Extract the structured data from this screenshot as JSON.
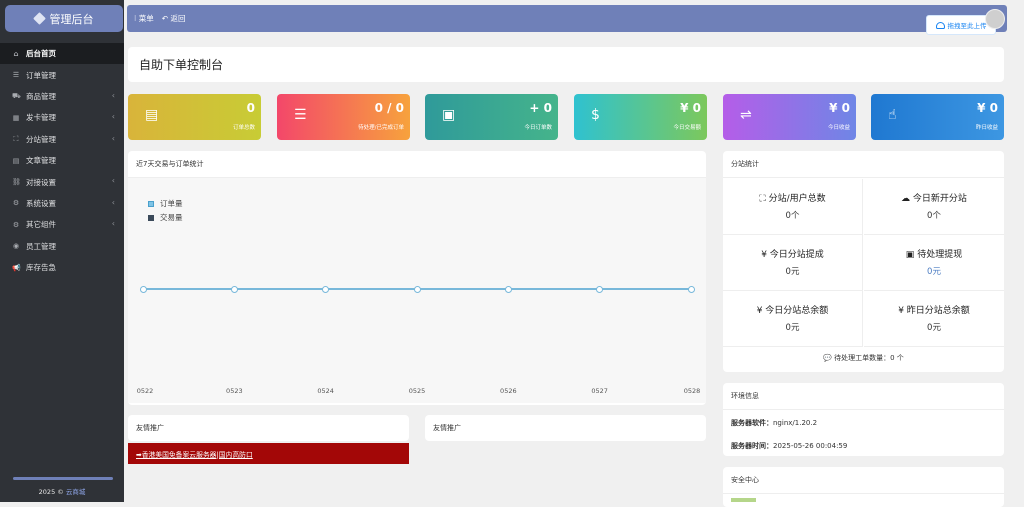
{
  "sidebar": {
    "brand": "管理后台",
    "items": [
      {
        "label": "后台首页",
        "icon": "home-icon",
        "glyph": "⌂",
        "active": true,
        "arrow": false
      },
      {
        "label": "订单管理",
        "icon": "list-icon",
        "glyph": "☰",
        "active": false,
        "arrow": false
      },
      {
        "label": "商品管理",
        "icon": "cart-icon",
        "glyph": "⛟",
        "active": false,
        "arrow": true
      },
      {
        "label": "发卡管理",
        "icon": "grid-icon",
        "glyph": "▦",
        "active": false,
        "arrow": true
      },
      {
        "label": "分站管理",
        "icon": "sitemap-icon",
        "glyph": "⛶",
        "active": false,
        "arrow": true
      },
      {
        "label": "文章管理",
        "icon": "book-icon",
        "glyph": "▤",
        "active": false,
        "arrow": false
      },
      {
        "label": "对接设置",
        "icon": "link-icon",
        "glyph": "⛓",
        "active": false,
        "arrow": true
      },
      {
        "label": "系统设置",
        "icon": "gear-icon",
        "glyph": "⚙",
        "active": false,
        "arrow": true
      },
      {
        "label": "其它组件",
        "icon": "gears-icon",
        "glyph": "⚙",
        "active": false,
        "arrow": true
      },
      {
        "label": "员工管理",
        "icon": "user-icon",
        "glyph": "◉",
        "active": false,
        "arrow": false
      },
      {
        "label": "库存告急",
        "icon": "bullhorn-icon",
        "glyph": "📢",
        "active": false,
        "arrow": false
      }
    ],
    "footer_year": "2025 ©",
    "footer_link": "云商城"
  },
  "topbar": {
    "menu": "⁝ 菜单",
    "back": "↶ 返回"
  },
  "upload": {
    "label": "拖拽至此上传"
  },
  "page_title": "自助下单控制台",
  "cards": [
    {
      "value": "0",
      "label": "订单总数",
      "icon": "table-icon",
      "glyph": "▤",
      "from": "#d9b43a",
      "to": "#c8cc35"
    },
    {
      "value": "0 / 0",
      "label": "待处理/已完成订单",
      "icon": "sliders-icon",
      "glyph": "☰",
      "from": "#f3476a",
      "to": "#f7a23d"
    },
    {
      "value": "+ 0",
      "label": "今日订单数",
      "icon": "calendar-plus-icon",
      "glyph": "▣",
      "from": "#2f9a9a",
      "to": "#45b48b"
    },
    {
      "value": "¥ 0",
      "label": "今日交易额",
      "icon": "dollar-icon",
      "glyph": "$",
      "from": "#2fc2d0",
      "to": "#7cc85c"
    },
    {
      "value": "¥ 0",
      "label": "今日收益",
      "icon": "handshake-icon",
      "glyph": "⇌",
      "from": "#b55de8",
      "to": "#6f86e6"
    },
    {
      "value": "¥ 0",
      "label": "昨日收益",
      "icon": "pointer-hand-icon",
      "glyph": "☝",
      "from": "#1f78d1",
      "to": "#3d97e2"
    }
  ],
  "trade_panel": {
    "title": "近7天交易与订单统计",
    "legend": [
      {
        "name": "订单量",
        "color": "#7fc4e6"
      },
      {
        "name": "交易量",
        "color": "#3b4a5a"
      }
    ]
  },
  "chart_data": {
    "type": "line",
    "x": [
      "0522",
      "0523",
      "0524",
      "0525",
      "0526",
      "0527",
      "0528"
    ],
    "series": [
      {
        "name": "订单量",
        "values": [
          0,
          0,
          0,
          0,
          0,
          0,
          0
        ],
        "color": "#78b8da"
      },
      {
        "name": "交易量",
        "values": [
          0,
          0,
          0,
          0,
          0,
          0,
          0
        ],
        "color": "#3b4a5a"
      }
    ],
    "grid": false,
    "legend_position": "top-left"
  },
  "substation": {
    "title": "分站统计",
    "cells": [
      {
        "label": "分站/用户总数",
        "value": "0个",
        "icon": "sitemap-icon",
        "glyph": "⛶"
      },
      {
        "label": "今日新开分站",
        "value": "0个",
        "icon": "cloud-icon",
        "glyph": "☁"
      },
      {
        "label": "今日分站提成",
        "value": "0元",
        "icon": "yen-icon",
        "glyph": "¥"
      },
      {
        "label": "待处理提现",
        "value": "0元",
        "icon": "money-icon",
        "glyph": "▣"
      },
      {
        "label": "今日分站总余额",
        "value": "0元",
        "icon": "yen-icon",
        "glyph": "¥"
      },
      {
        "label": "昨日分站总余额",
        "value": "0元",
        "icon": "yen-icon",
        "glyph": "¥"
      }
    ],
    "ticket": "待处理工单数量：0 个"
  },
  "env": {
    "title": "环境信息",
    "software_label": "服务器软件：",
    "software_value": "nginx/1.20.2",
    "time_label": "服务器时间：",
    "time_value": "2025-05-26 00:04:59"
  },
  "friend_links": [
    {
      "title": "友情推广"
    },
    {
      "title": "友情推广"
    }
  ],
  "ad_text": "➡香港美国免备案云服务器|国内高防口",
  "security": {
    "title": "安全中心"
  }
}
